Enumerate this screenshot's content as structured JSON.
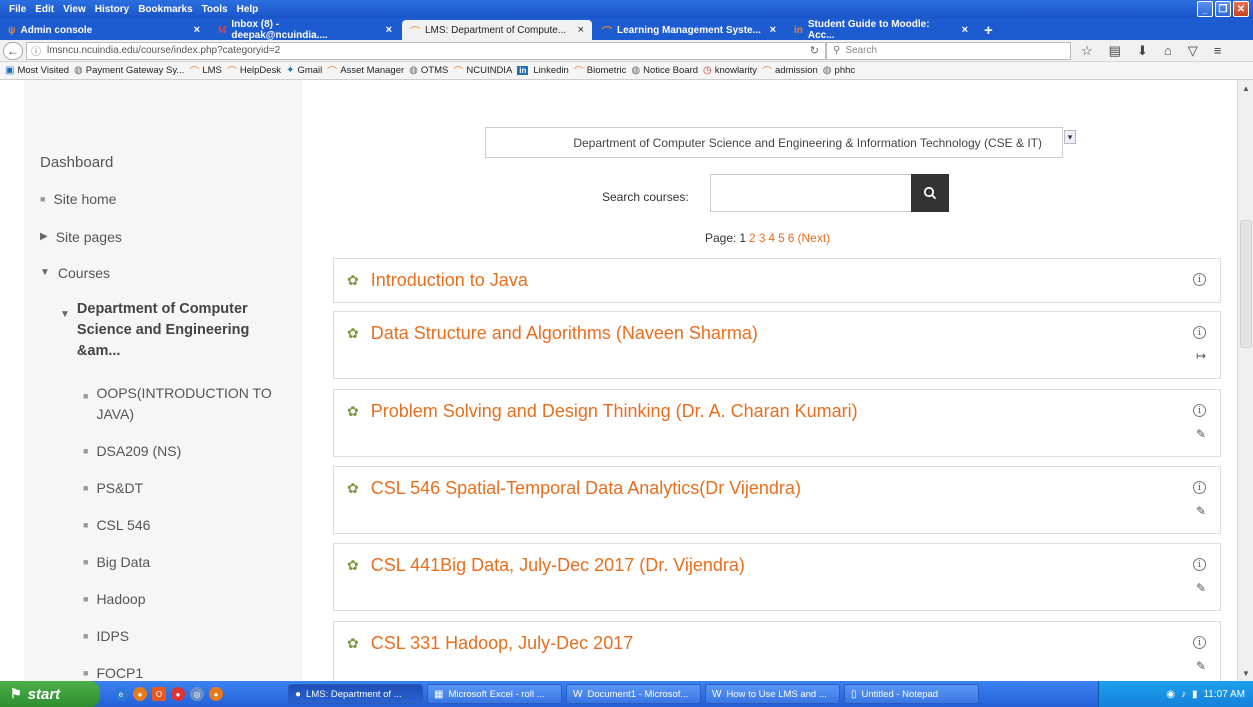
{
  "menu": [
    "File",
    "Edit",
    "View",
    "History",
    "Bookmarks",
    "Tools",
    "Help"
  ],
  "tabs": [
    {
      "label": "Admin console",
      "icon": "moodle-icon"
    },
    {
      "label": "Inbox (8) - deepak@ncuindia....",
      "icon": "gmail-icon"
    },
    {
      "label": "LMS: Department of Compute...",
      "icon": "moodle-icon"
    },
    {
      "label": "Learning Management Syste...",
      "icon": "moodle-icon"
    },
    {
      "label": "Student Guide to Moodle: Acc...",
      "icon": "linkedin-icon"
    }
  ],
  "nav": {
    "url": "lmsncu.ncuindia.edu/course/index.php?categoryid=2",
    "search_placeholder": "Search"
  },
  "bookmarks": [
    "Most Visited",
    "Payment Gateway Sy...",
    "LMS",
    "HelpDesk",
    "Gmail",
    "Asset Manager",
    "OTMS",
    "NCUINDIA",
    "Linkedin",
    "Biometric",
    "Notice Board",
    "knowlarity",
    "admission",
    "phhc"
  ],
  "sidebar": {
    "dashboard": "Dashboard",
    "site_home": "Site home",
    "site_pages": "Site pages",
    "courses": "Courses",
    "department": "Department of Computer Science and Engineering &am...",
    "course_links": [
      "OOPS(INTRODUCTION TO JAVA)",
      "DSA209 (NS)",
      "PS&DT",
      "CSL 546",
      "Big Data",
      "Hadoop",
      "IDPS",
      "FOCP1"
    ]
  },
  "main": {
    "category_select": "Department of Computer Science and Engineering & Information Technology (CSE & IT)",
    "search_label": "Search courses:",
    "page_label": "Page:",
    "pages": [
      "1",
      "2",
      "3",
      "4",
      "5",
      "6"
    ],
    "next_label": "(Next)",
    "courses": [
      {
        "title": "Introduction to Java",
        "enrol": false
      },
      {
        "title": "Data Structure and Algorithms (Naveen Sharma)",
        "enrol": true
      },
      {
        "title": "Problem Solving and Design Thinking (Dr. A. Charan Kumari)",
        "enrol": true
      },
      {
        "title": "CSL 546 Spatial-Temporal Data Analytics(Dr Vijendra)",
        "enrol": true
      },
      {
        "title": "CSL 441Big Data, July-Dec 2017 (Dr. Vijendra)",
        "enrol": true
      },
      {
        "title": "CSL 331 Hadoop, July-Dec 2017",
        "enrol": true
      }
    ]
  },
  "taskbar": {
    "start": "start",
    "items": [
      "LMS: Department of ...",
      "Microsoft Excel - roll ...",
      "Document1 - Microsof...",
      "How to Use LMS and ...",
      "Untitled - Notepad"
    ],
    "time": "11:07 AM"
  },
  "colors": {
    "accent": "#e86e1e",
    "title_bar": "#1d5bd0",
    "taskbar": "#2460d8"
  }
}
